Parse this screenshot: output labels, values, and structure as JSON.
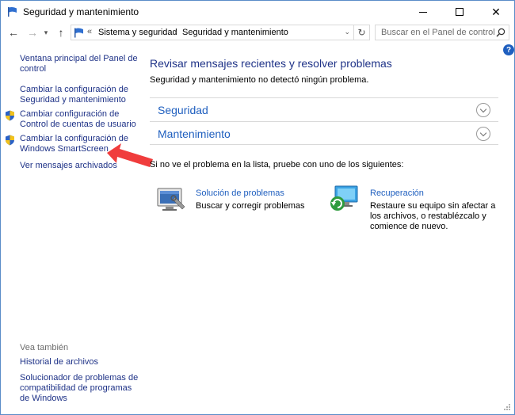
{
  "window": {
    "title": "Seguridad y mantenimiento"
  },
  "address": {
    "overflow": "«",
    "crumbs": [
      "Sistema y seguridad",
      "Seguridad y mantenimiento"
    ]
  },
  "search": {
    "placeholder": "Buscar en el Panel de control"
  },
  "help": {
    "label": "?"
  },
  "sidebar": {
    "links": [
      "Ventana principal del Panel de control",
      "Cambiar la configuración de Seguridad y mantenimiento",
      "Cambiar configuración de Control de cuentas de usuario",
      "Cambiar la configuración de Windows SmartScreen",
      "Ver mensajes archivados"
    ],
    "see_also_title": "Vea también",
    "see_also": [
      "Historial de archivos",
      "Solucionador de problemas de compatibilidad de programas de Windows"
    ]
  },
  "main": {
    "title": "Revisar mensajes recientes y resolver problemas",
    "subtitle": "Seguridad y mantenimiento no detectó ningún problema.",
    "sections": [
      "Seguridad",
      "Mantenimiento"
    ],
    "suggest": "Si no ve el problema en la lista, pruebe con uno de los siguientes:",
    "tools": [
      {
        "name": "Solución de problemas",
        "desc": "Buscar y corregir problemas"
      },
      {
        "name": "Recuperación",
        "desc": "Restaure su equipo sin afectar a los archivos, o restablézcalo y comience de nuevo."
      }
    ]
  },
  "colors": {
    "link": "#1e3287",
    "accent": "#1f5fbf",
    "arrow": "#f03c3c"
  }
}
